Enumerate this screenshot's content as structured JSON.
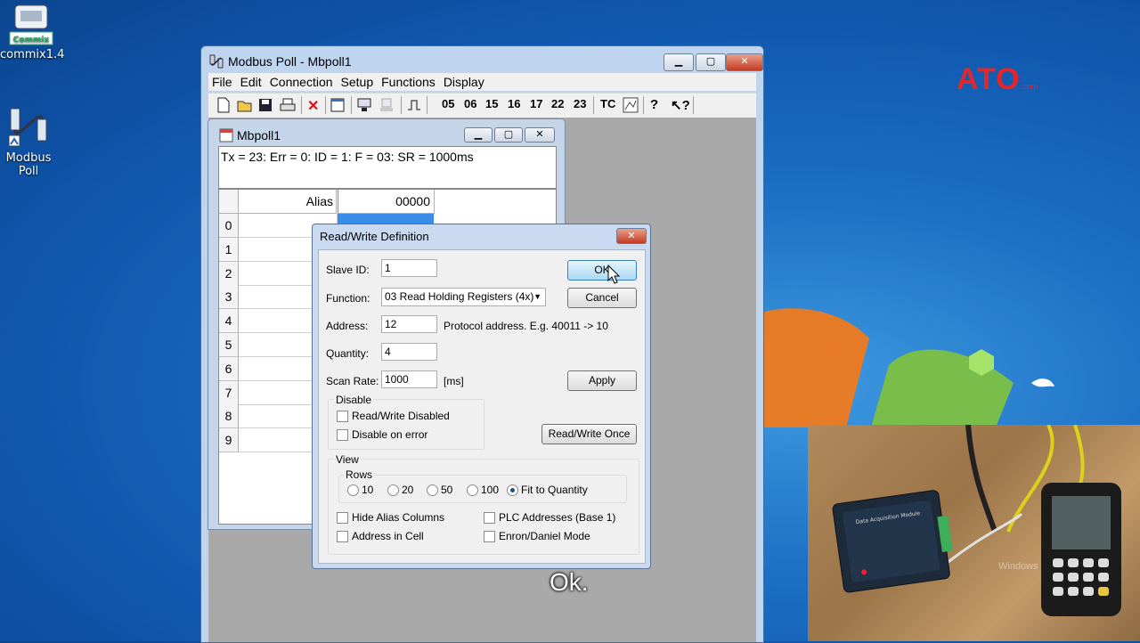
{
  "desktop": {
    "icons": [
      {
        "label": "commix1.4",
        "badge": "Commix"
      },
      {
        "label": "Modbus\nPoll"
      }
    ],
    "brand": {
      "text": "ATO",
      "sub": ".com"
    },
    "watermark": "Windows"
  },
  "main_window": {
    "title": "Modbus Poll - Mbpoll1",
    "menu": [
      "File",
      "Edit",
      "Connection",
      "Setup",
      "Functions",
      "Display"
    ],
    "toolbar_codes": [
      "05",
      "06",
      "15",
      "16",
      "17",
      "22",
      "23",
      "TC"
    ]
  },
  "child_window": {
    "title": "Mbpoll1",
    "status": "Tx = 23: Err = 0: ID = 1: F = 03: SR = 1000ms",
    "grid": {
      "alias_header": "Alias",
      "col_header": "00000",
      "rows": [
        "0",
        "1",
        "2",
        "3",
        "4",
        "5",
        "6",
        "7",
        "8",
        "9"
      ]
    }
  },
  "dialog": {
    "title": "Read/Write Definition",
    "slave_id": {
      "label": "Slave ID:",
      "value": "1"
    },
    "function": {
      "label": "Function:",
      "value": "03 Read Holding Registers (4x)"
    },
    "address": {
      "label": "Address:",
      "value": "12",
      "hint": "Protocol address. E.g. 40011 -> 10"
    },
    "quantity": {
      "label": "Quantity:",
      "value": "4"
    },
    "scan_rate": {
      "label": "Scan Rate:",
      "value": "1000",
      "unit": "[ms]"
    },
    "buttons": {
      "ok": "OK",
      "cancel": "Cancel",
      "apply": "Apply",
      "rw_once": "Read/Write Once"
    },
    "disable": {
      "title": "Disable",
      "rw_disabled": "Read/Write Disabled",
      "on_error": "Disable on error"
    },
    "view": {
      "title": "View",
      "rows_title": "Rows",
      "rows_options": [
        "10",
        "20",
        "50",
        "100",
        "Fit to Quantity"
      ],
      "selected_rows": "Fit to Quantity",
      "hide_alias": "Hide Alias Columns",
      "plc_addresses": "PLC Addresses (Base 1)",
      "address_in_cell": "Address in Cell",
      "enron": "Enron/Daniel Mode"
    }
  },
  "caption": "Ok.",
  "colors": {
    "brand_red": "#e8262a",
    "desktop_blue": "#1c6fc4",
    "dialog_frame": "#c9daf0"
  }
}
